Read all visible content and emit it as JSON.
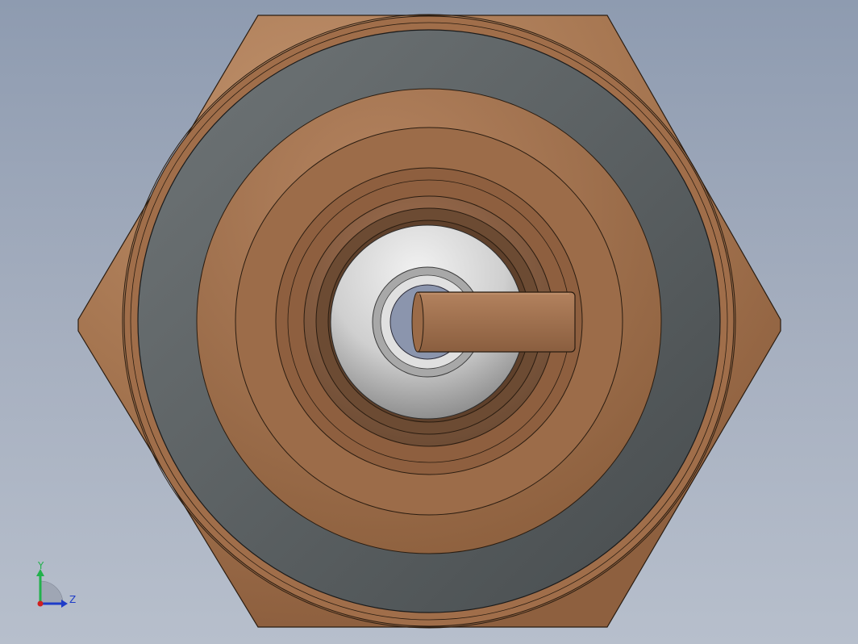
{
  "viewport": {
    "background_top": "#8e9bb0",
    "background_bottom": "#b7bfcc"
  },
  "part": {
    "body_color": "#a8734f",
    "ring_color": "#5b6163",
    "insert_color": "#d0d0d0",
    "pin_color": "#8b95ad"
  },
  "triad": {
    "y_label": "Y",
    "z_label": "Z",
    "y_color": "#22b14c",
    "z_color": "#1e3cc8",
    "origin_color": "#d02020"
  }
}
